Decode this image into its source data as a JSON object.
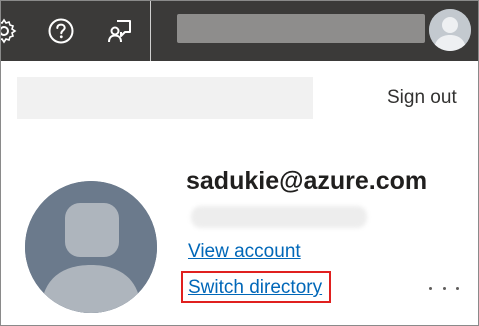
{
  "topbar": {
    "background": "#3b3a39",
    "icons": {
      "settings": "gear-icon",
      "help": "question-circle-icon",
      "feedback": "feedback-person-icon"
    },
    "account_avatar": "avatar-icon"
  },
  "menu": {
    "sign_out_label": "Sign out"
  },
  "profile": {
    "email": "sadukie@azure.com",
    "view_account_label": "View account",
    "switch_directory_label": "Switch directory",
    "more_options": "ellipsis-icon"
  },
  "colors": {
    "link": "#0067b8",
    "highlight_border": "#e0201f",
    "avatar_big_bg": "#6b7a8c"
  }
}
